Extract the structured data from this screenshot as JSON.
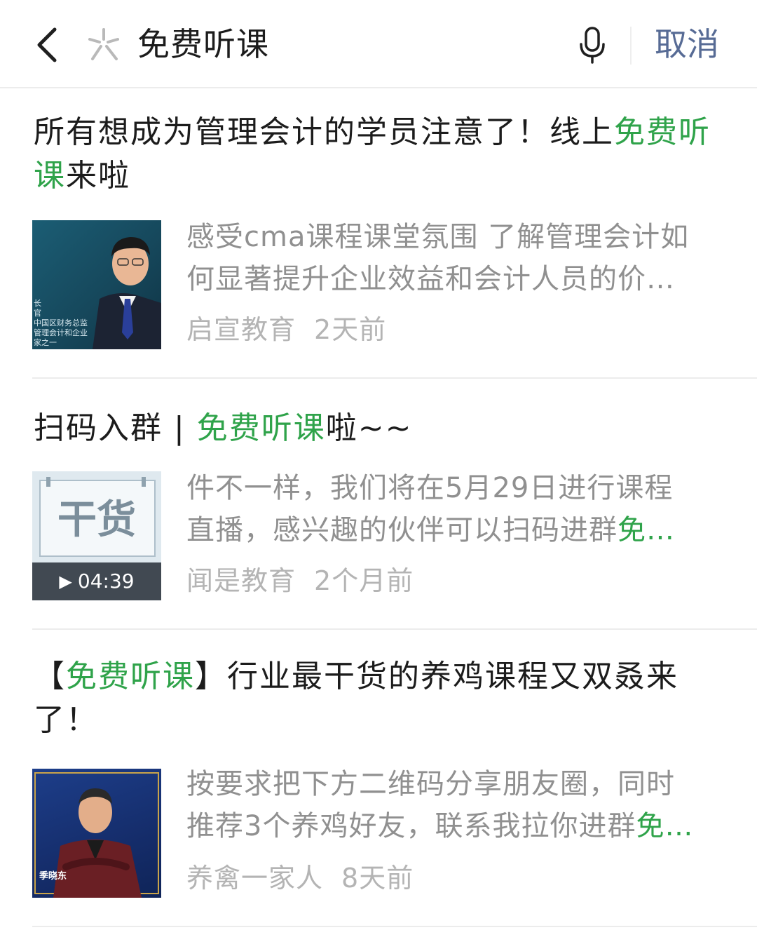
{
  "header": {
    "query": "免费听课",
    "cancel_label": "取消",
    "icons": {
      "back": "chevron-left-icon",
      "search": "search-logo-icon",
      "mic": "microphone-icon"
    },
    "accent_color": "#576b95"
  },
  "highlight_color": "#2fa34a",
  "results": [
    {
      "title_before": "所有想成为管理会计的学员注意了！线上",
      "title_highlight": "免费听课",
      "title_after": "来啦",
      "summary_line1": "感受cma课程课堂氛围 了解管理会计如",
      "summary_line2": "何显著提升企业效益和会计人员的价…",
      "summary_highlight": "",
      "source": "启宣教育",
      "time": "2天前",
      "thumb_caption_lines": [
        "长",
        "官",
        "中国区财务总监",
        "管理会计和企业",
        "家之一"
      ]
    },
    {
      "title_before": "扫码入群 | ",
      "title_highlight": "免费听课",
      "title_after": "啦~~",
      "summary_line1": "件不一样，我们将在5月29日进行课程",
      "summary_line2": "直播，感兴趣的伙伴可以扫码进群",
      "summary_highlight": "免…",
      "source": "闻是教育",
      "time": "2个月前",
      "thumb_text": "干货",
      "duration": "04:39"
    },
    {
      "title_before": "【",
      "title_highlight": "免费听课",
      "title_after": "】行业最干货的养鸡课程又双叒来了！",
      "summary_line1": "按要求把下方二维码分享朋友圈，同时",
      "summary_line2": "推荐3个养鸡好友，联系我拉你进群",
      "summary_highlight": "免…",
      "source": "养禽一家人",
      "time": "8天前",
      "thumb_caption": "季晓东"
    }
  ]
}
